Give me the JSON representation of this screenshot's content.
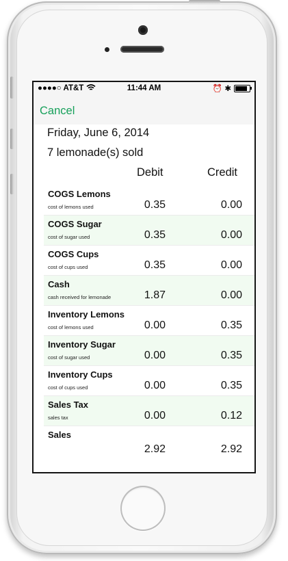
{
  "status": {
    "carrier": "●●●●○ AT&T",
    "time": "11:44 AM",
    "icons": "⏰ ✱"
  },
  "nav": {
    "cancel_label": "Cancel"
  },
  "summary": {
    "date": "Friday, June 6, 2014",
    "sold": "7 lemonade(s) sold"
  },
  "columns": {
    "debit": "Debit",
    "credit": "Credit"
  },
  "rows": [
    {
      "title": "COGS Lemons",
      "sub": "cost of lemons used",
      "debit": "0.35",
      "credit": "0.00"
    },
    {
      "title": "COGS Sugar",
      "sub": "cost of sugar used",
      "debit": "0.35",
      "credit": "0.00"
    },
    {
      "title": "COGS Cups",
      "sub": "cost of cups used",
      "debit": "0.35",
      "credit": "0.00"
    },
    {
      "title": "Cash",
      "sub": "cash received for lemonade",
      "debit": "1.87",
      "credit": "0.00"
    },
    {
      "title": "Inventory Lemons",
      "sub": "cost of lemons used",
      "debit": "0.00",
      "credit": "0.35"
    },
    {
      "title": "Inventory Sugar",
      "sub": "cost of sugar used",
      "debit": "0.00",
      "credit": "0.35"
    },
    {
      "title": "Inventory Cups",
      "sub": "cost of cups used",
      "debit": "0.00",
      "credit": "0.35"
    },
    {
      "title": "Sales Tax",
      "sub": "sales tax",
      "debit": "0.00",
      "credit": "0.12"
    },
    {
      "title": "Sales"
    }
  ],
  "totals": {
    "debit": "2.92",
    "credit": "2.92"
  },
  "colors": {
    "accent": "#16a05a",
    "alt_row": "#f1fbf1"
  }
}
